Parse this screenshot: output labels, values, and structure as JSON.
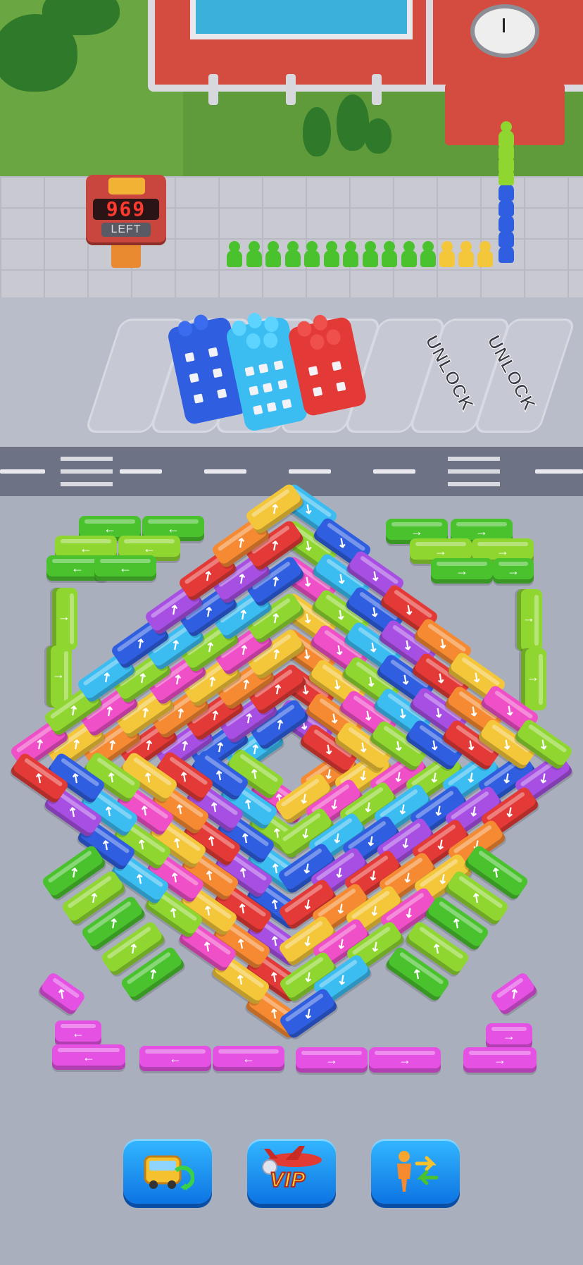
{
  "counter": {
    "value": "969",
    "label": "LEFT"
  },
  "slots": {
    "unlock_1": "UNLOCK",
    "unlock_2": "UNLOCK"
  },
  "buttons": {
    "vip_label": "VIP"
  },
  "colors": {
    "green": "#49c22e",
    "lime": "#8fd631",
    "pink": "#ef4fc7",
    "purple": "#a74fe3",
    "cyan": "#3bbdf2",
    "blue": "#2f5fe0",
    "red": "#e33a37",
    "orange": "#f58a32",
    "yellow": "#f4c63a",
    "magenta": "#e451e3"
  },
  "icons": [
    "bus-shuffle-icon",
    "vip-plane-icon",
    "swap-passenger-icon",
    "arrow-icon"
  ]
}
